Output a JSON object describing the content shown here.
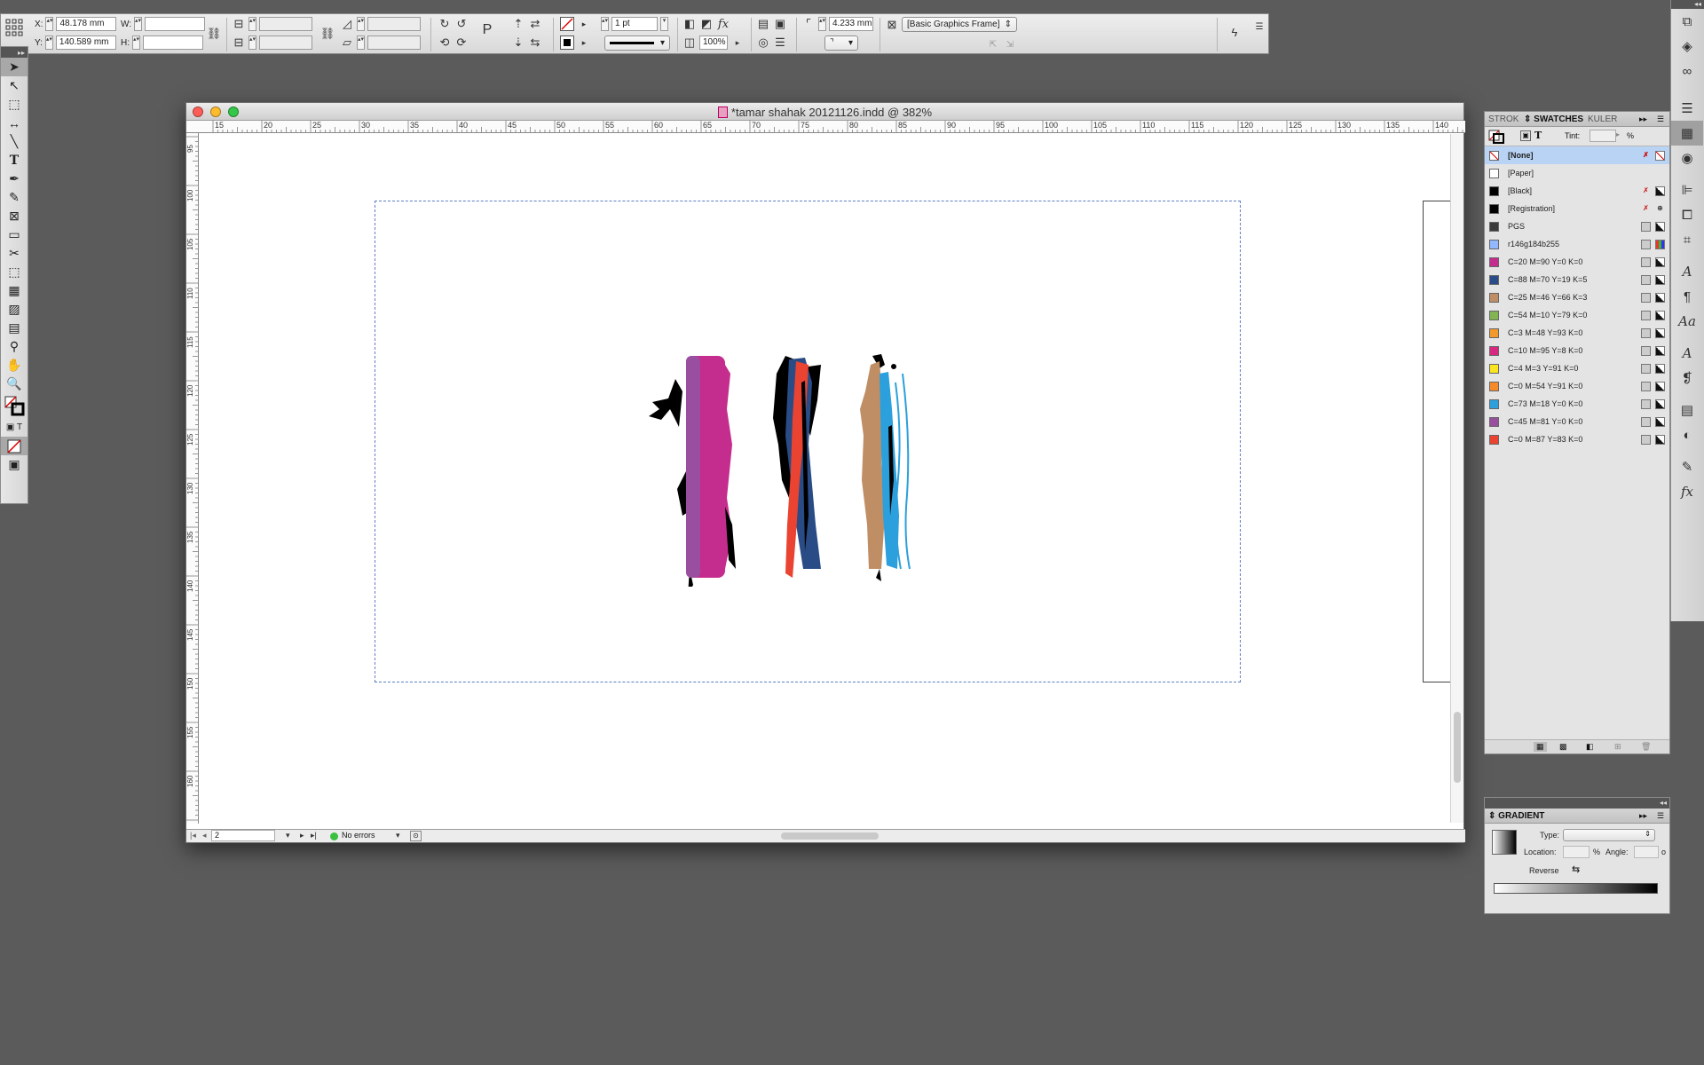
{
  "control_bar": {
    "x_label": "X:",
    "x_value": "48.178 mm",
    "y_label": "Y:",
    "y_value": "140.589 mm",
    "w_label": "W:",
    "w_value": "",
    "h_label": "H:",
    "h_value": "",
    "stroke_weight": "1 pt",
    "opacity": "100%",
    "fitting_offset": "4.233 mm",
    "object_style": "[Basic Graphics Frame]"
  },
  "document": {
    "title": "*tamar shahak 20121126.indd @ 382%",
    "page_number": "2",
    "preflight_status": "No errors",
    "ruler_top": [
      "15",
      "20",
      "25",
      "30",
      "35",
      "40",
      "45",
      "50",
      "55",
      "60",
      "65",
      "70",
      "75",
      "80",
      "85",
      "90",
      "95",
      "100",
      "105",
      "110",
      "115",
      "120",
      "125",
      "130",
      "135",
      "140"
    ],
    "ruler_left": [
      "95",
      "100",
      "105",
      "110",
      "115",
      "120",
      "125",
      "130",
      "135",
      "140",
      "145",
      "150",
      "155",
      "160",
      "165"
    ]
  },
  "swatches_panel": {
    "tabs": [
      "STROK",
      "SWATCHES",
      "KULER"
    ],
    "tint_label": "Tint:",
    "tint_value": "",
    "tint_unit": "%",
    "swatches": [
      {
        "name": "[None]",
        "color": "none"
      },
      {
        "name": "[Paper]",
        "color": "#ffffff"
      },
      {
        "name": "[Black]",
        "color": "#000000"
      },
      {
        "name": "[Registration]",
        "color": "#000000"
      },
      {
        "name": "PGS",
        "color": "#3a3a3a"
      },
      {
        "name": "r146g184b255",
        "color": "#92b8ff"
      },
      {
        "name": "C=20 M=90 Y=0 K=0",
        "color": "#c42d8d"
      },
      {
        "name": "C=88 M=70 Y=19 K=5",
        "color": "#2a4c86"
      },
      {
        "name": "C=25 M=46 Y=66 K=3",
        "color": "#c08e64"
      },
      {
        "name": "C=54 M=10 Y=79 K=0",
        "color": "#82b552"
      },
      {
        "name": "C=3 M=48 Y=93 K=0",
        "color": "#f2992c"
      },
      {
        "name": "C=10 M=95 Y=8 K=0",
        "color": "#d9287f"
      },
      {
        "name": "C=4 M=3 Y=91 K=0",
        "color": "#fbe51f"
      },
      {
        "name": "C=0 M=54 Y=91 K=0",
        "color": "#f58a2a"
      },
      {
        "name": "C=73 M=18 Y=0 K=0",
        "color": "#2ba0dc"
      },
      {
        "name": "C=45 M=81 Y=0 K=0",
        "color": "#9a4ea0"
      },
      {
        "name": "C=0 M=87 Y=83 K=0",
        "color": "#ea4331"
      }
    ]
  },
  "gradient_panel": {
    "title": "GRADIENT",
    "type_label": "Type:",
    "location_label": "Location:",
    "location_unit": "%",
    "angle_label": "Angle:",
    "angle_unit": "o",
    "reverse_label": "Reverse"
  },
  "colors": {
    "stroke_pink": "#c42d8d",
    "stroke_purple": "#9a4ea0",
    "stroke_navy": "#2a4c86",
    "stroke_red": "#ea4331",
    "stroke_tan": "#c08e64",
    "stroke_blue": "#2ba0dc"
  }
}
